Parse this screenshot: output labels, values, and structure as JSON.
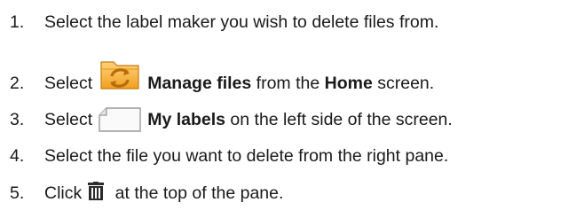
{
  "steps": [
    {
      "number": "1.",
      "text": "Select the label maker you wish to delete files from."
    },
    {
      "number": "2.",
      "before": "Select",
      "icon": "manage-files-icon",
      "bold": "Manage files",
      "middle": " from the ",
      "bold2": "Home",
      "after": " screen."
    },
    {
      "number": "3.",
      "before": "Select",
      "icon": "my-labels-icon",
      "bold": "My labels",
      "after": " on the left side of the screen."
    },
    {
      "number": "4.",
      "text": "Select the file you want to delete from the right pane."
    },
    {
      "number": "5.",
      "before": "Click",
      "icon": "trash-icon",
      "after": " at the top of the pane."
    }
  ],
  "colors": {
    "text": "#1a1a1a",
    "manage_icon_orange": "#f0a020",
    "manage_icon_light": "#ffd27a",
    "labels_icon_border": "#9a9a9a",
    "trash_icon": "#2b2b2b"
  }
}
